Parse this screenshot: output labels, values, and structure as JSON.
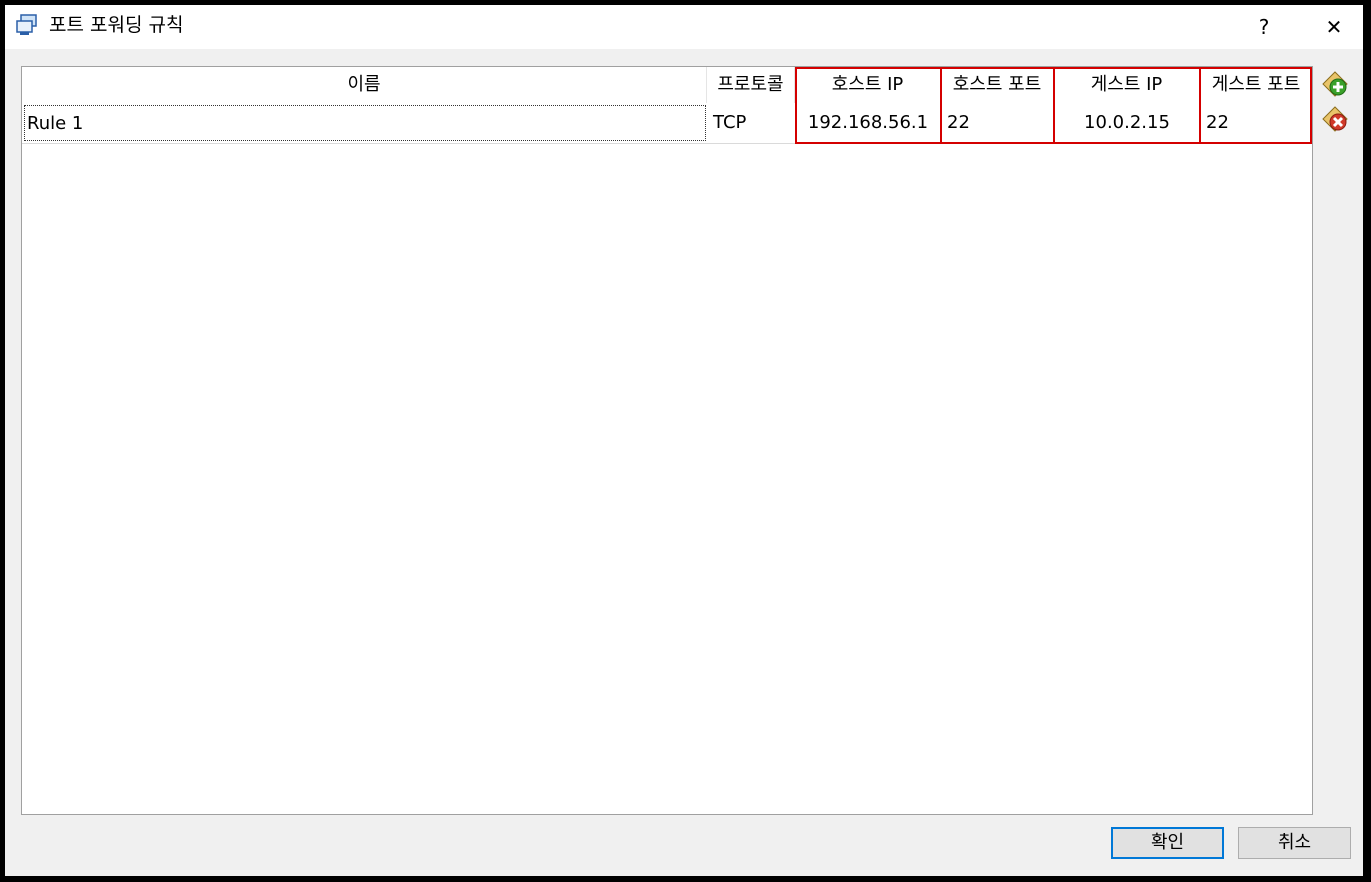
{
  "window": {
    "title": "포트 포워딩 규칙",
    "help_label": "?",
    "close_label": "✕"
  },
  "table": {
    "columns": [
      "이름",
      "프로토콜",
      "호스트 IP",
      "호스트 포트",
      "게스트 IP",
      "게스트 포트"
    ],
    "rows": [
      {
        "name": "Rule 1",
        "protocol": "TCP",
        "host_ip": "192.168.56.1",
        "host_port": "22",
        "guest_ip": "10.0.2.15",
        "guest_port": "22"
      }
    ]
  },
  "icons": {
    "window_icon": "virtualbox-network-icon",
    "add_rule": "add-rule-icon",
    "remove_rule": "remove-rule-icon"
  },
  "buttons": {
    "ok": "확인",
    "cancel": "취소"
  },
  "colors": {
    "highlight": "#d40000",
    "add_green": "#3aa12a",
    "remove_red": "#d03a2a",
    "focus_blue": "#0078d7"
  }
}
